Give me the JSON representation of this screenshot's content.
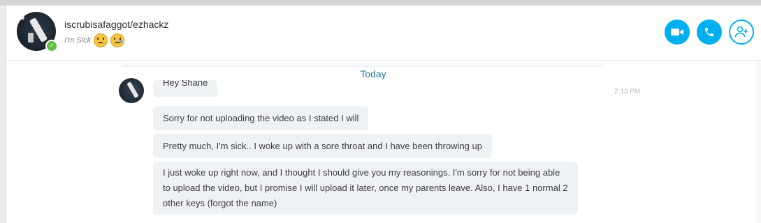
{
  "contact": {
    "name": "iscrubisafaggot/ezhackz",
    "mood": "I'm Sick"
  },
  "header_actions": {
    "video": "video-call",
    "call": "audio-call",
    "add": "add-participant"
  },
  "conversation": {
    "day_label": "Today",
    "timestamp": "2:13 PM",
    "messages": [
      "Hey Shane",
      "Sorry for not uploading the video as I stated I will",
      "Pretty much, I'm sick.. I woke up with a sore throat and I have been throwing up",
      "I just woke up right now, and I thought I should give you my reasonings. I'm sorry for not being able to upload the video, but I promise I will upload it later, once my parents leave. Also, I have 1 normal 2 other keys (forgot the name)"
    ]
  },
  "colors": {
    "accent": "#00aff0",
    "bubble": "#eff2f5",
    "today": "#2b7aa8",
    "online": "#5fbf3f"
  }
}
